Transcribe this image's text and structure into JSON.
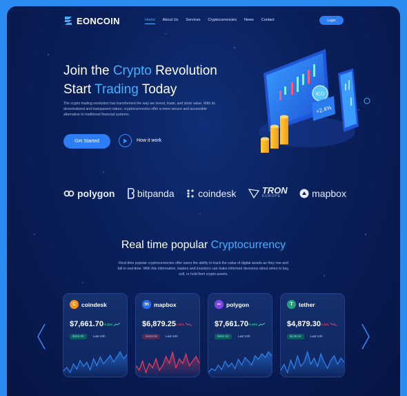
{
  "brand": {
    "name": "EONCOIN",
    "logo_icon": "eoncoin-logo-icon"
  },
  "nav": {
    "items": [
      {
        "label": "Home",
        "active": true
      },
      {
        "label": "About Us",
        "active": false
      },
      {
        "label": "Services",
        "active": false
      },
      {
        "label": "Cryptocurrencies",
        "active": false
      },
      {
        "label": "News",
        "active": false
      },
      {
        "label": "Contact",
        "active": false
      }
    ],
    "login_label": "Login"
  },
  "hero": {
    "line1_a": "Join the ",
    "line1_b": "Crypto",
    "line1_c": " Revolution",
    "line2_a": "Start ",
    "line2_b": "Trading",
    "line2_c": " Today",
    "paragraph": "The crypto trading revolution has transformed the way we invest, trade, and store value. With its decentralized and transparent nature, cryptocurrencies offer a more secure and accessible alternative to traditional financial systems.",
    "cta_label": "Get Started",
    "how_label": "How it work",
    "illustration_labels": {
      "coin": "ICO",
      "percent": "+2.4%"
    }
  },
  "partners": [
    {
      "name": "polygon",
      "icon": "polygon-logo-icon"
    },
    {
      "name": "bitpanda",
      "icon": "bitpanda-logo-icon"
    },
    {
      "name": "coindesk",
      "icon": "coindesk-logo-icon"
    },
    {
      "name": "TRON",
      "sub": "EUROPE",
      "icon": "tron-logo-icon"
    },
    {
      "name": "mapbox",
      "icon": "mapbox-logo-icon"
    }
  ],
  "section": {
    "title_a": "Real time popular ",
    "title_b": "Cryptocurrency",
    "paragraph": "Real-time popular cryptocurrencies offer users the ability to track the value of digital assets as they rise and fall in real-time. With this information, traders and investors can make informed decisions about when to buy, sell, or hold their crypto assets."
  },
  "colors": {
    "accent": "#3fb1ff",
    "button": "#2d7df5",
    "up": "#3ff0b0",
    "down": "#ff4d6d"
  },
  "cards": [
    {
      "name": "coindesk",
      "icon_glyph": "C",
      "icon_color": "#f7931a",
      "price": "$7,661.70",
      "change": "+6.34%",
      "trend": "up",
      "pill": "$383.00",
      "last": "Last 24h",
      "series": [
        14,
        18,
        12,
        22,
        16,
        26,
        19,
        24,
        15,
        28,
        20,
        30,
        22,
        27,
        32,
        24,
        30,
        36,
        28,
        33
      ]
    },
    {
      "name": "mapbox",
      "icon_glyph": "m",
      "icon_color": "#2c6df0",
      "price": "$6,879.25",
      "change": "-1.34%",
      "trend": "down",
      "pill": "-$253.00",
      "last": "Last 24h",
      "series": [
        22,
        18,
        26,
        16,
        24,
        20,
        28,
        18,
        22,
        30,
        24,
        34,
        20,
        28,
        24,
        32,
        22,
        26,
        30,
        24
      ]
    },
    {
      "name": "polygon",
      "icon_glyph": "∞",
      "icon_color": "#8247e5",
      "price": "$7,661.70",
      "change": "+6.34%",
      "trend": "up",
      "pill": "$383.00",
      "last": "Last 24h",
      "series": [
        12,
        16,
        14,
        20,
        15,
        24,
        18,
        22,
        16,
        26,
        20,
        28,
        24,
        20,
        30,
        26,
        32,
        28,
        34,
        30
      ]
    },
    {
      "name": "tether",
      "icon_glyph": "T",
      "icon_color": "#26a17b",
      "price": "$4,879.30",
      "change": "-4.34%",
      "trend": "down",
      "pill": "$138.00",
      "last": "Last 24h",
      "series": [
        16,
        22,
        14,
        26,
        18,
        30,
        20,
        24,
        34,
        22,
        28,
        20,
        32,
        24,
        18,
        26,
        30,
        22,
        28,
        24
      ]
    }
  ]
}
